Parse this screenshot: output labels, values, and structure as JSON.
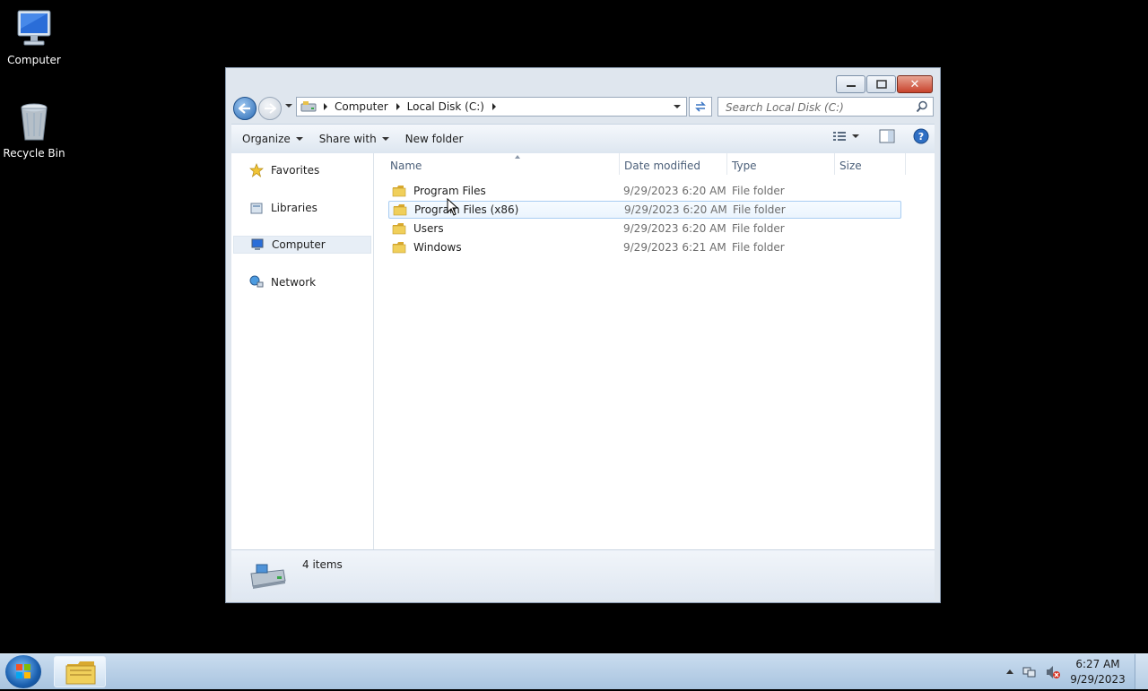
{
  "desktop": {
    "icons": [
      {
        "label": "Computer"
      },
      {
        "label": "Recycle Bin"
      }
    ]
  },
  "window": {
    "address": {
      "crumbs": [
        "Computer",
        "Local Disk (C:)"
      ]
    },
    "search": {
      "placeholder": "Search Local Disk (C:)"
    },
    "toolbar": {
      "organize": "Organize",
      "share_with": "Share with",
      "new_folder": "New folder"
    },
    "nav_pane": {
      "items": [
        {
          "label": "Favorites"
        },
        {
          "label": "Libraries"
        },
        {
          "label": "Computer",
          "selected": true
        },
        {
          "label": "Network"
        }
      ]
    },
    "columns": {
      "name": "Name",
      "date": "Date modified",
      "type": "Type",
      "size": "Size"
    },
    "files": [
      {
        "name": "Program Files",
        "date": "9/29/2023 6:20 AM",
        "type": "File folder"
      },
      {
        "name": "Program Files (x86)",
        "date": "9/29/2023 6:20 AM",
        "type": "File folder",
        "hover": true
      },
      {
        "name": "Users",
        "date": "9/29/2023 6:20 AM",
        "type": "File folder"
      },
      {
        "name": "Windows",
        "date": "9/29/2023 6:21 AM",
        "type": "File folder"
      }
    ],
    "status": {
      "count": "4 items"
    }
  },
  "taskbar": {
    "clock": {
      "time": "6:27 AM",
      "date": "9/29/2023"
    }
  },
  "colors": {
    "accent": "#2b6bb5",
    "selection_border": "#a9cdf2",
    "folder": "#e8c14a"
  },
  "icons": [
    "computer-icon",
    "recycle-bin-icon",
    "star-icon",
    "library-icon",
    "network-icon",
    "folder-icon",
    "drive-icon",
    "search-icon",
    "refresh-icon",
    "help-icon",
    "view-icon",
    "preview-pane-icon"
  ]
}
